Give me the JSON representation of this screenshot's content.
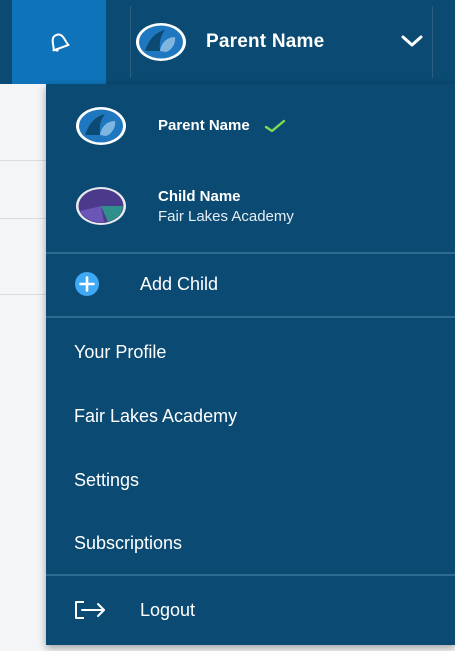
{
  "topbar": {
    "account_name": "Parent Name",
    "bell_icon": "bell-icon",
    "chevron_icon": "chevron-down-icon"
  },
  "dropdown": {
    "profiles": [
      {
        "name": "Parent Name",
        "school": "",
        "selected": true,
        "avatar_icon": "parent-avatar"
      },
      {
        "name": "Child Name",
        "school": "Fair Lakes Academy",
        "selected": false,
        "avatar_icon": "child-avatar"
      }
    ],
    "add_child_label": "Add Child",
    "menu": {
      "your_profile": "Your Profile",
      "school": "Fair Lakes Academy",
      "settings": "Settings",
      "subscriptions": "Subscriptions",
      "logout": "Logout"
    }
  },
  "colors": {
    "navy": "#0b4a72",
    "bell_button": "#0e73b9",
    "check": "#7ed957",
    "add_icon": "#3fa9f5"
  }
}
